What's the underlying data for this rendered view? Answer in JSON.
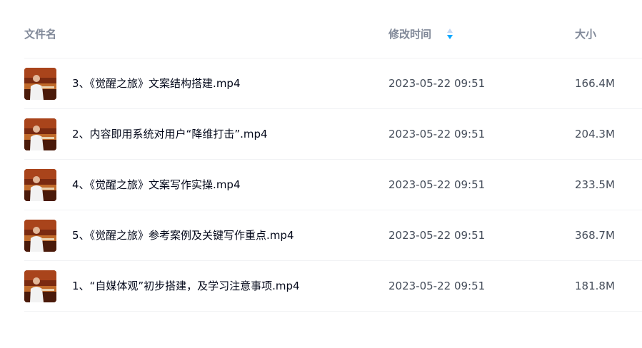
{
  "header": {
    "name_label": "文件名",
    "time_label": "修改时间",
    "size_label": "大小",
    "sort_icon": "sort-icon",
    "sort_active_color": "#06a7ff",
    "sort_inactive_color": "#c4d8f4"
  },
  "files": [
    {
      "name": "3、《觉醒之旅》文案结构搭建.mp4",
      "modified": "2023-05-22 09:51",
      "size": "166.4M",
      "thumbnail": "video-thumbnail"
    },
    {
      "name": "2、内容即用系统对用户“降维打击”.mp4",
      "modified": "2023-05-22 09:51",
      "size": "204.3M",
      "thumbnail": "video-thumbnail"
    },
    {
      "name": "4、《觉醒之旅》文案写作实操.mp4",
      "modified": "2023-05-22 09:51",
      "size": "233.5M",
      "thumbnail": "video-thumbnail"
    },
    {
      "name": "5、《觉醒之旅》参考案例及关键写作重点.mp4",
      "modified": "2023-05-22 09:51",
      "size": "368.7M",
      "thumbnail": "video-thumbnail"
    },
    {
      "name": "1、“自媒体观”初步搭建，及学习注意事项.mp4",
      "modified": "2023-05-22 09:51",
      "size": "181.8M",
      "thumbnail": "video-thumbnail"
    }
  ]
}
